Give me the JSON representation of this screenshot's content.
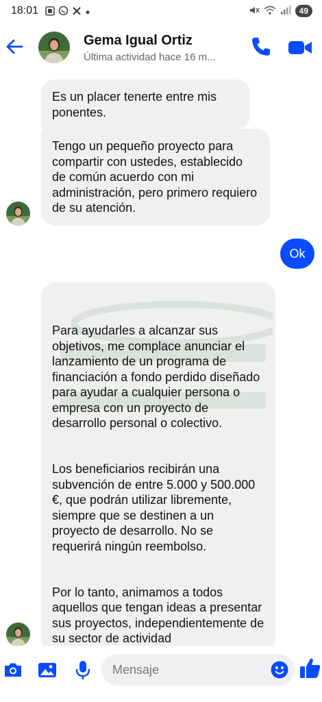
{
  "status_bar": {
    "time": "18:01",
    "icons_left": [
      "screenshot-icon",
      "whatsapp-icon",
      "x-icon",
      "dot-icon"
    ],
    "icons_right": [
      "mute-icon",
      "wifi-icon",
      "signal-icon"
    ],
    "battery": "49"
  },
  "header": {
    "contact_name": "Gema Igual Ortiz",
    "last_active": "Última actividad hace 16 m...",
    "icons": [
      "back-arrow-icon",
      "phone-icon",
      "video-camera-icon"
    ]
  },
  "messages": [
    {
      "sender": "contact",
      "text": "Es un placer tenerte entre mis ponentes."
    },
    {
      "sender": "contact",
      "text": "Tengo un pequeño proyecto para compartir con ustedes, establecido de común acuerdo con mi administración, pero primero requiero de su atención."
    },
    {
      "sender": "me",
      "text": "Ok"
    },
    {
      "sender": "contact",
      "paragraphs": [
        "Para ayudarles a alcanzar sus objetivos, me complace anunciar el lanzamiento de un programa de financiación a fondo perdido diseñado para ayudar a cualquier persona o empresa con un proyecto de desarrollo personal o colectivo.",
        "Los beneficiarios recibirán una subvención de entre 5.000 y 500.000 €, que podrán utilizar libremente, siempre que se destinen a un proyecto de desarrollo. No se requerirá ningún reembolso.",
        "Por lo tanto, animamos a todos aquellos que tengan ideas a presentar sus proyectos, independientemente de su sector de actividad"
      ]
    }
  ],
  "composer": {
    "placeholder": "Mensaje",
    "icons": [
      "camera-icon",
      "gallery-icon",
      "microphone-icon",
      "emoji-icon",
      "thumbs-up-icon"
    ]
  },
  "colors": {
    "accent": "#0a4bff",
    "bubble_incoming": "#f0f0f2"
  }
}
